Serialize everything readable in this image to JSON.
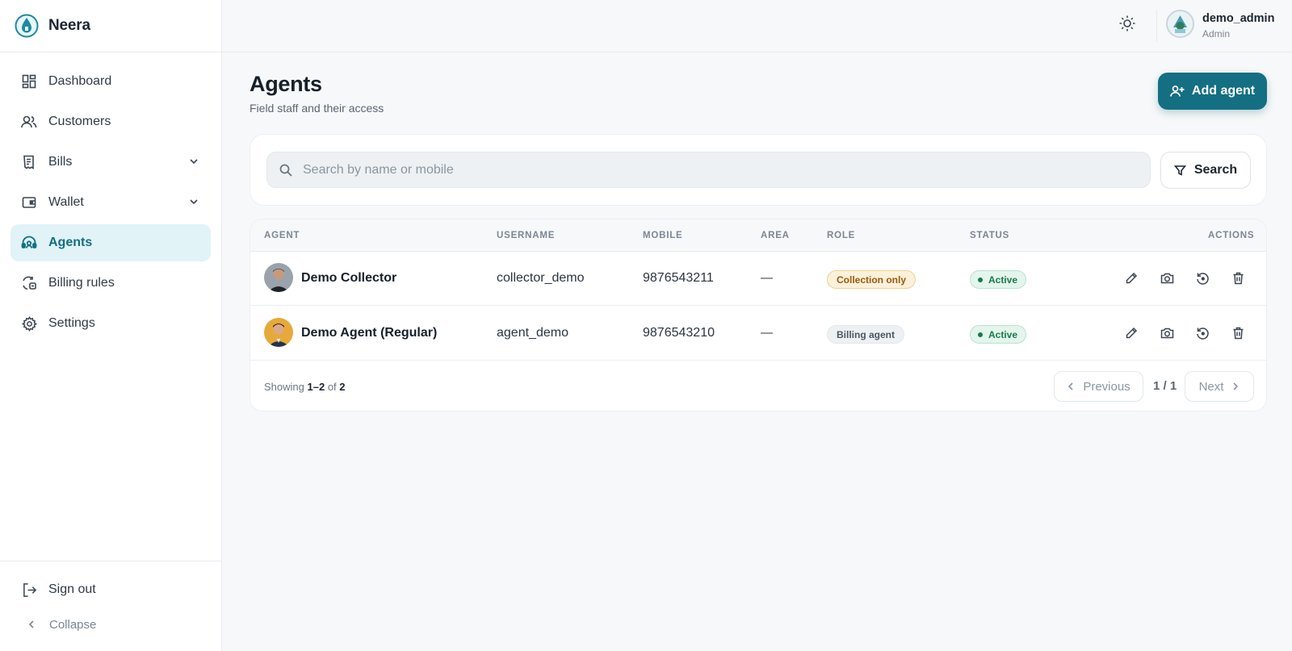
{
  "brand": {
    "name": "Neera",
    "logo_icon": "water-drop-logo"
  },
  "sidebar": {
    "items": [
      {
        "label": "Dashboard",
        "icon": "dashboard-icon"
      },
      {
        "label": "Customers",
        "icon": "users-icon"
      },
      {
        "label": "Bills",
        "icon": "receipt-icon",
        "expandable": true
      },
      {
        "label": "Wallet",
        "icon": "wallet-icon",
        "expandable": true
      },
      {
        "label": "Agents",
        "icon": "headset-icon",
        "active": true
      },
      {
        "label": "Billing rules",
        "icon": "refresh-rules-icon"
      },
      {
        "label": "Settings",
        "icon": "gear-icon"
      }
    ],
    "sign_out": "Sign out",
    "collapse": "Collapse"
  },
  "topbar": {
    "theme_icon": "sun-icon",
    "user": {
      "name": "demo_admin",
      "role": "Admin"
    }
  },
  "page": {
    "title": "Agents",
    "subtitle": "Field staff and their access",
    "add_button": "Add agent"
  },
  "search": {
    "placeholder": "Search by name or mobile",
    "value": "",
    "button": "Search"
  },
  "table": {
    "columns": [
      "AGENT",
      "USERNAME",
      "MOBILE",
      "AREA",
      "ROLE",
      "STATUS",
      "ACTIONS"
    ],
    "rows": [
      {
        "agent": "Demo Collector",
        "username": "collector_demo",
        "mobile": "9876543211",
        "area": "—",
        "role": "Collection only",
        "status": "Active"
      },
      {
        "agent": "Demo Agent (Regular)",
        "username": "agent_demo",
        "mobile": "9876543210",
        "area": "—",
        "role": "Billing agent",
        "status": "Active"
      }
    ],
    "action_icons": [
      "edit-icon",
      "camera-icon",
      "reset-icon",
      "trash-icon"
    ]
  },
  "pagination": {
    "showing_prefix": "Showing",
    "range": "1–2",
    "of_word": "of",
    "total": "2",
    "previous": "Previous",
    "page": "1 / 1",
    "next": "Next"
  },
  "colors": {
    "accent": "#146f82",
    "active_nav_bg": "#e1f3f7",
    "status_active": "#177a4a",
    "role_collection": "#9a5a07"
  }
}
